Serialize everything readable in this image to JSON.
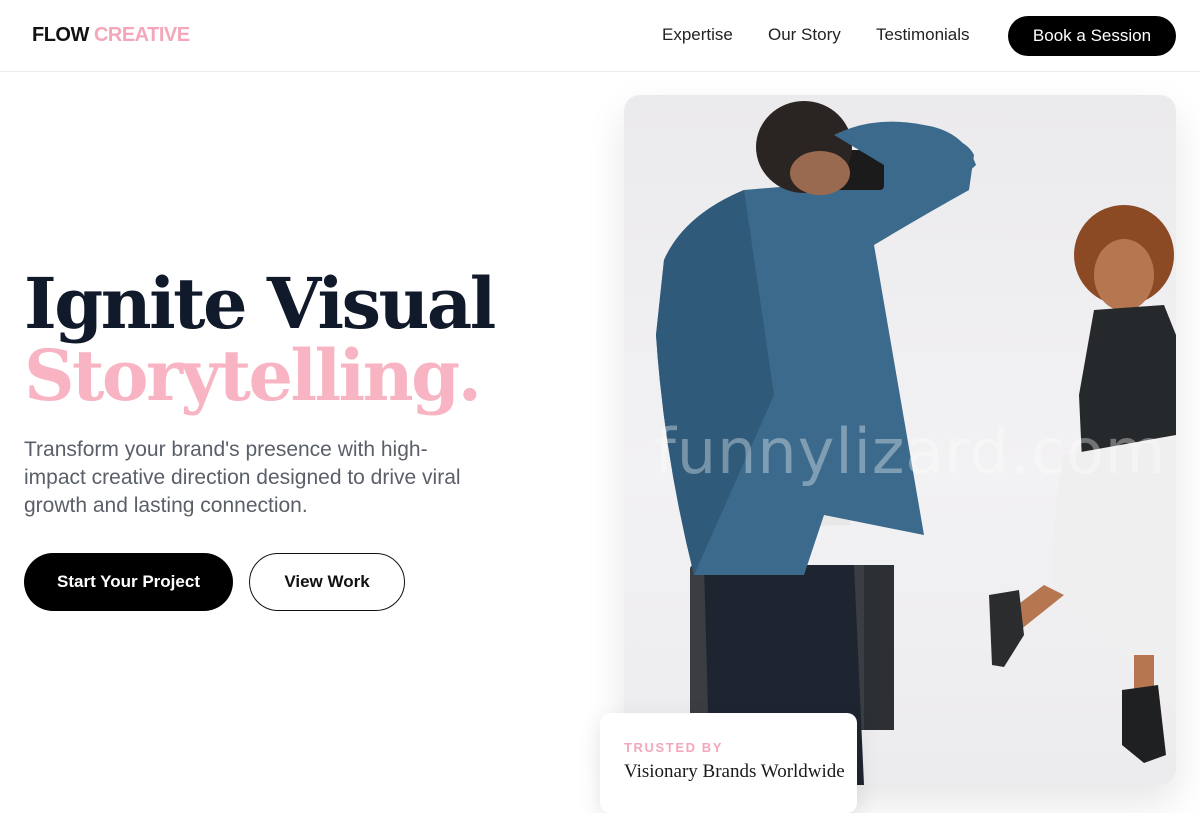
{
  "brand": {
    "name_part1": "FLOW",
    "name_part2": "CREATIVE",
    "accent_color": "#f4a7b9"
  },
  "nav": {
    "items": [
      {
        "label": "Expertise"
      },
      {
        "label": "Our Story"
      },
      {
        "label": "Testimonials"
      }
    ],
    "cta_label": "Book a Session"
  },
  "hero": {
    "title_line1": "Ignite Visual",
    "title_line2": "Storytelling.",
    "subtitle": "Transform your brand's presence with high-impact creative direction designed to drive viral growth and lasting connection.",
    "primary_cta": "Start Your Project",
    "secondary_cta": "View Work"
  },
  "image": {
    "watermark": "funnylizard.com"
  },
  "trust_card": {
    "label": "TRUSTED BY",
    "text": "Visionary Brands Worldwide"
  }
}
